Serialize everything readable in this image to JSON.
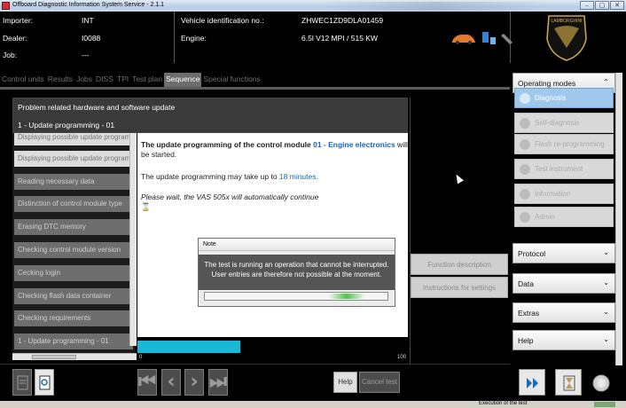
{
  "window": {
    "title": "Offboard Diagnostic Information System Service - 2.1.1",
    "buttons": [
      "–",
      "▢",
      "✕"
    ]
  },
  "info": {
    "importer_label": "Importer:",
    "importer_value": "INT",
    "dealer_label": "Dealer:",
    "dealer_value": "I0088",
    "job_label": "Job:",
    "job_value": "---",
    "vin_label": "Vehicle identification no.:",
    "vin_value": "ZHWEC1ZD9DLA01459",
    "engine_label": "Engine:",
    "engine_value": "6.5l V12 MPI / 515 KW",
    "logo_text": "LAMBORGHINI"
  },
  "tabs": [
    {
      "label": "Control units",
      "active": false
    },
    {
      "label": "Results",
      "active": false
    },
    {
      "label": "Jobs",
      "active": false
    },
    {
      "label": "DISS",
      "active": false
    },
    {
      "label": "TPI",
      "active": false
    },
    {
      "label": "Test plan",
      "active": false
    },
    {
      "label": "Sequence",
      "active": true
    },
    {
      "label": "Special functions",
      "active": false
    }
  ],
  "problem": {
    "title": "Problem related hardware and software update",
    "subtitle": "1 - Update programming - 01"
  },
  "steps": [
    {
      "label": "Displaying possible update program",
      "style": "light"
    },
    {
      "label": "Displaying possible update program",
      "style": "light"
    },
    {
      "label": "Reading necessary data",
      "style": "dark"
    },
    {
      "label": "Distinction of control module type",
      "style": "dark"
    },
    {
      "label": "Erasing DTC memory",
      "style": "dark"
    },
    {
      "label": "Checking control module version",
      "style": "dark"
    },
    {
      "label": "Cecking login",
      "style": "dark"
    },
    {
      "label": "Checking flash data container",
      "style": "dark"
    },
    {
      "label": "Checking requirements",
      "style": "dark"
    },
    {
      "label": "1 - Update programming - 01",
      "style": "dark"
    }
  ],
  "content": {
    "line1_a": "The update programming of the control module ",
    "line1_b": "01 - Engine electronics",
    "line1_c": " will",
    "line2": "be started.",
    "line3_a": "The update programming may take up to ",
    "line3_b": "18 minutes.",
    "line4": "Please wait, the VAS 505x will automatically continue",
    "hourglass": "⌛"
  },
  "progress": {
    "min": "0",
    "max": "100",
    "value": 38
  },
  "side_buttons": {
    "function_description": "Function description",
    "instructions": "Instructions for settings"
  },
  "note": {
    "title": "Note",
    "line1": "The test is running an operation that cannot be interrupted.",
    "line2": "User entries are therefore not possible at the moment."
  },
  "bottom": {
    "help": "Help",
    "cancel": "Cancel test"
  },
  "opmodes": {
    "header": "Operating modes",
    "items": [
      {
        "label": "Diagnosis",
        "selected": true
      },
      {
        "label": "Self-diagnosis",
        "selected": false
      },
      {
        "label": "Flash re-programming",
        "selected": false
      },
      {
        "label": "Test instrument",
        "selected": false
      },
      {
        "label": "Information",
        "selected": false
      },
      {
        "label": "Admin",
        "selected": false
      }
    ],
    "protocol": "Protocol",
    "data": "Data",
    "extras": "Extras",
    "help": "Help"
  },
  "status": {
    "text": "Execution of the test"
  }
}
